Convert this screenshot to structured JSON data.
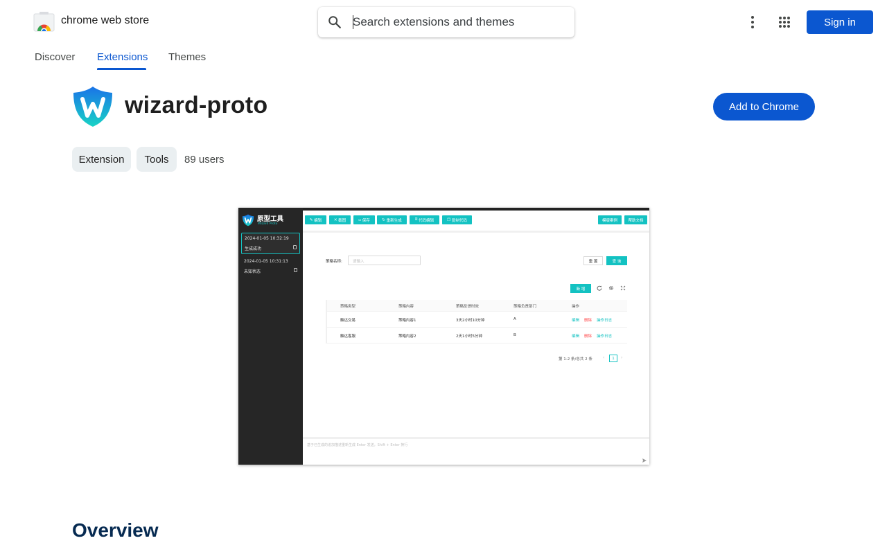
{
  "header": {
    "store_name": "chrome web store",
    "search_placeholder": "Search extensions and themes",
    "sign_in_label": "Sign in"
  },
  "nav": {
    "tabs": [
      {
        "label": "Discover",
        "active": false
      },
      {
        "label": "Extensions",
        "active": true
      },
      {
        "label": "Themes",
        "active": false
      }
    ]
  },
  "item": {
    "title": "wizard-proto",
    "add_button_label": "Add to Chrome",
    "chips": [
      "Extension",
      "Tools"
    ],
    "users": "89 users"
  },
  "preview": {
    "brand": "原型工具",
    "brand_sub": "Wizard Proto",
    "history": [
      {
        "time": "2024-01-05 10:32:19",
        "status": "生成成功",
        "active": true
      },
      {
        "time": "2024-01-05 10:31:13",
        "status": "未知状态",
        "active": false
      }
    ],
    "toolbar": [
      "编辑",
      "截图",
      "保存",
      "重新生成",
      "代码编辑",
      "复制代码"
    ],
    "toolbar_right": [
      "模版案例",
      "帮助文档"
    ],
    "filter_label": "策略名称:",
    "filter_placeholder": "请输入",
    "reset_label": "重 置",
    "query_label": "查 询",
    "new_label": "新 增",
    "columns": [
      "策略类型",
      "策略内容",
      "策略反馈时效",
      "策略负责部门",
      "操作"
    ],
    "rows": [
      {
        "type": "触达交易",
        "content": "策略内容1",
        "timeliness": "3天2小时10分钟",
        "dept": "A"
      },
      {
        "type": "触达客服",
        "content": "策略内容2",
        "timeliness": "2天1小时5分钟",
        "dept": "B"
      }
    ],
    "actions": {
      "edit": "编辑",
      "delete": "删除",
      "log": "操作日志"
    },
    "pager_text": "第 1-2 条/总共 2 条",
    "current_page": "1",
    "chat_placeholder": "基于已生成的追加描述重新生成 Enter 发送，Shift + Enter 换行",
    "accent_color": "#13c2c2",
    "delete_color": "#ff4d4f"
  },
  "overview_heading": "Overview",
  "colors": {
    "primary": "#0b57d0",
    "text": "#1f1f1f",
    "chip_bg": "#eaeff1"
  }
}
